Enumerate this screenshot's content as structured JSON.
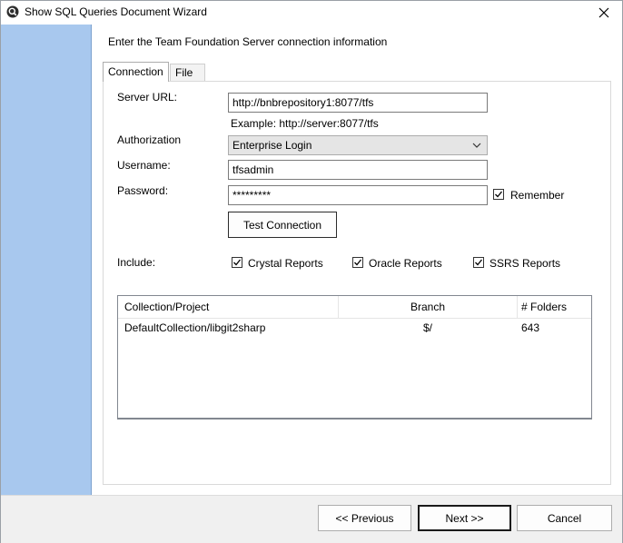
{
  "window": {
    "title": "Show SQL Queries Document Wizard"
  },
  "content": {
    "heading": "Enter the Team Foundation Server connection information"
  },
  "tabs": [
    {
      "label": "Connection",
      "active": true
    },
    {
      "label": "File Filter",
      "active": false
    }
  ],
  "form": {
    "server_url_label": "Server URL:",
    "server_url_value": "http://bnbrepository1:8077/tfs",
    "server_url_example": "Example: http://server:8077/tfs",
    "authorization_label": "Authorization",
    "authorization_value": "Enterprise Login",
    "username_label": "Username:",
    "username_value": "tfsadmin",
    "password_label": "Password:",
    "password_value": "*********",
    "remember_label": "Remember",
    "remember_checked": true,
    "test_connection_label": "Test Connection",
    "include_label": "Include:",
    "include_options": [
      {
        "label": "Crystal Reports",
        "checked": true
      },
      {
        "label": "Oracle Reports",
        "checked": true
      },
      {
        "label": "SSRS Reports",
        "checked": true
      }
    ]
  },
  "table": {
    "columns": [
      "Collection/Project",
      "Branch",
      "# Folders"
    ],
    "rows": [
      [
        "DefaultCollection/libgit2sharp",
        "$/",
        "643"
      ]
    ]
  },
  "footer": {
    "previous_label": "<< Previous",
    "next_label": "Next >>",
    "cancel_label": "Cancel"
  },
  "colors": {
    "sidebar": "#a8c8ee",
    "dialog_background": "#f0f0f0"
  }
}
